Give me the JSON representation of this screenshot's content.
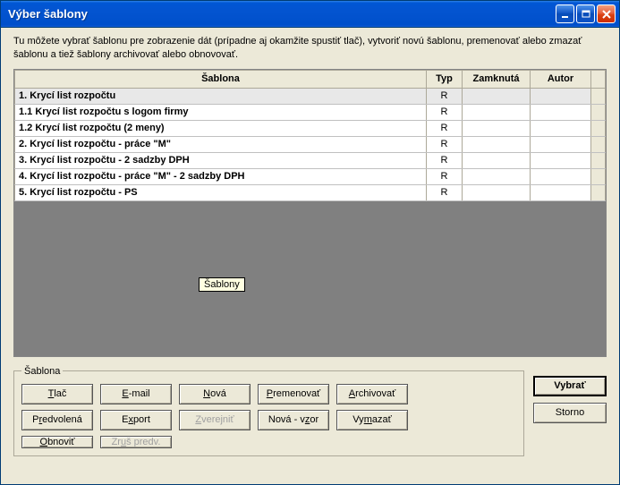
{
  "window": {
    "title": "Výber šablony"
  },
  "description": "Tu môžete vybrať šablonu pre zobrazenie dát (prípadne aj okamžite spustiť tlač), vytvoriť novú šablonu, premenovať alebo zmazať šablonu a tiež šablony archivovať alebo obnovovať.",
  "columns": {
    "sablona": "Šablona",
    "typ": "Typ",
    "zamknuta": "Zamknutá",
    "autor": "Autor"
  },
  "rows": [
    {
      "name": "1. Krycí list rozpočtu",
      "typ": "R",
      "zamknuta": "",
      "autor": "",
      "selected": true
    },
    {
      "name": "1.1 Krycí list rozpočtu s logom firmy",
      "typ": "R",
      "zamknuta": "",
      "autor": "",
      "selected": false
    },
    {
      "name": "1.2 Krycí list rozpočtu (2 meny)",
      "typ": "R",
      "zamknuta": "",
      "autor": "",
      "selected": false
    },
    {
      "name": "2. Krycí list rozpočtu - práce \"M\"",
      "typ": "R",
      "zamknuta": "",
      "autor": "",
      "selected": false
    },
    {
      "name": "3. Krycí list rozpočtu - 2 sadzby DPH",
      "typ": "R",
      "zamknuta": "",
      "autor": "",
      "selected": false
    },
    {
      "name": "4. Krycí list rozpočtu - práce \"M\" - 2 sadzby DPH",
      "typ": "R",
      "zamknuta": "",
      "autor": "",
      "selected": false
    },
    {
      "name": "5. Krycí list rozpočtu - PS",
      "typ": "R",
      "zamknuta": "",
      "autor": "",
      "selected": false
    }
  ],
  "tooltip": "Šablony",
  "group": {
    "legend": "Šablona",
    "buttons": {
      "tlac": "Tlač",
      "email": "E-mail",
      "nova": "Nová",
      "premenovat": "Premenovať",
      "archivovat": "Archivovať",
      "predvolena": "Predvolená",
      "export": "Export",
      "zverejnit": "Zverejniť",
      "novavzor": "Nová - vzor",
      "vymazat": "Vymazať",
      "obnovit": "Obnoviť",
      "zruspredv": "Zruš predv."
    }
  },
  "actions": {
    "vybrat": "Vybrať",
    "storno": "Storno"
  }
}
